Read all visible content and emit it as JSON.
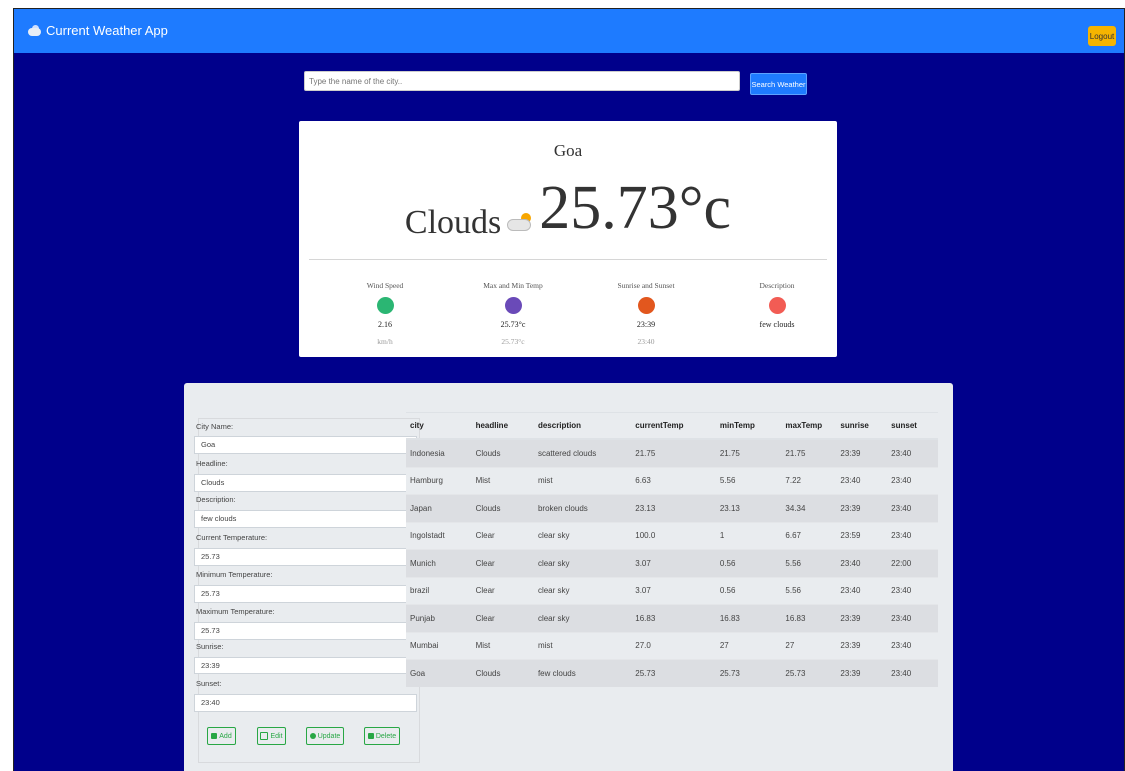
{
  "app": {
    "title": "Current Weather App",
    "logout_label": "Logout"
  },
  "search": {
    "placeholder": "Type the name of the city..",
    "button_label": "Search Weather"
  },
  "weather": {
    "city": "Goa",
    "headline": "Clouds",
    "temperature": "25.73°c",
    "stats": [
      {
        "title": "Wind Speed",
        "value": "2.16",
        "sub": "km/h",
        "icon": "wind-icon",
        "color": "#2bb673"
      },
      {
        "title": "Max and Min Temp",
        "value": "25.73°c",
        "sub": "25.73°c",
        "icon": "thermometer-icon",
        "color": "#6a4ab8"
      },
      {
        "title": "Sunrise and Sunset",
        "value": "23:39",
        "sub": "23:40",
        "icon": "sun-icon",
        "color": "#e2571e"
      },
      {
        "title": "Description",
        "value": "few clouds",
        "sub": "",
        "icon": "cloud-icon",
        "color": "#f25c54"
      }
    ]
  },
  "form": {
    "fields": [
      {
        "label": "City Name:",
        "value": "Goa"
      },
      {
        "label": "Headline:",
        "value": "Clouds"
      },
      {
        "label": "Description:",
        "value": "few clouds"
      },
      {
        "label": "Current Temperature:",
        "value": "25.73"
      },
      {
        "label": "Minimum Temperature:",
        "value": "25.73"
      },
      {
        "label": "Maximum Temperature:",
        "value": "25.73"
      },
      {
        "label": "Sunrise:",
        "value": "23:39"
      },
      {
        "label": "Sunset:",
        "value": "23:40"
      }
    ],
    "buttons": {
      "add": "Add",
      "edit": "Edit",
      "update": "Update",
      "delete": "Delete"
    }
  },
  "table": {
    "headers": [
      "city",
      "headline",
      "description",
      "currentTemp",
      "minTemp",
      "maxTemp",
      "sunrise",
      "sunset"
    ],
    "rows": [
      [
        "Indonesia",
        "Clouds",
        "scattered clouds",
        "21.75",
        "21.75",
        "21.75",
        "23:39",
        "23:40"
      ],
      [
        "Hamburg",
        "Mist",
        "mist",
        "6.63",
        "5.56",
        "7.22",
        "23:40",
        "23:40"
      ],
      [
        "Japan",
        "Clouds",
        "broken clouds",
        "23.13",
        "23.13",
        "34.34",
        "23:39",
        "23:40"
      ],
      [
        "Ingolstadt",
        "Clear",
        "clear sky",
        "100.0",
        "1",
        "6.67",
        "23:59",
        "23:40"
      ],
      [
        "Munich",
        "Clear",
        "clear sky",
        "3.07",
        "0.56",
        "5.56",
        "23:40",
        "22:00"
      ],
      [
        "brazil",
        "Clear",
        "clear sky",
        "3.07",
        "0.56",
        "5.56",
        "23:40",
        "23:40"
      ],
      [
        "Punjab",
        "Clear",
        "clear sky",
        "16.83",
        "16.83",
        "16.83",
        "23:39",
        "23:40"
      ],
      [
        "Mumbai",
        "Mist",
        "mist",
        "27.0",
        "27",
        "27",
        "23:39",
        "23:40"
      ],
      [
        "Goa",
        "Clouds",
        "few clouds",
        "25.73",
        "25.73",
        "25.73",
        "23:39",
        "23:40"
      ]
    ]
  }
}
